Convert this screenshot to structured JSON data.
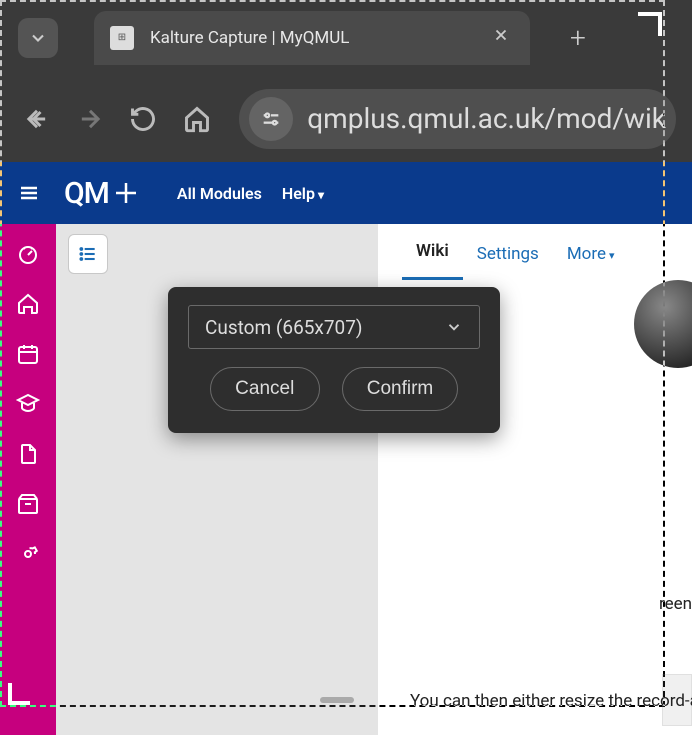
{
  "browser": {
    "tab_title": "Kalture Capture | MyQMUL",
    "url_display": "qmplus.qmul.ac.uk/mod/wik"
  },
  "site_header": {
    "logo_text": "QM",
    "menu": {
      "all_modules": "All Modules",
      "help": "Help"
    }
  },
  "tabs": {
    "wiki": "Wiki",
    "settings": "Settings",
    "more": "More"
  },
  "modal": {
    "size_label": "Custom (665x707)",
    "cancel": "Cancel",
    "confirm": "Confirm"
  },
  "body": {
    "right_fragment": "reen",
    "instruction_line": "You can then either resize the record-al le area"
  }
}
